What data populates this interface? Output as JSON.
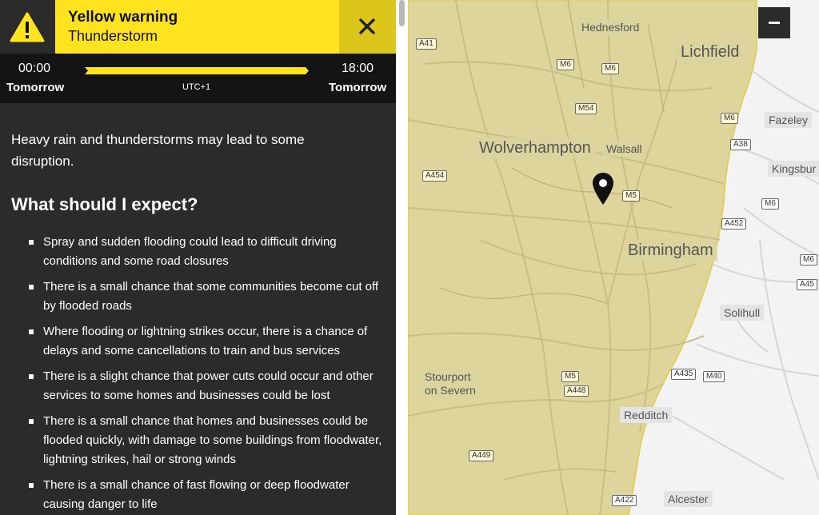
{
  "warning": {
    "level": "Yellow warning",
    "type": "Thunderstorm",
    "icon": "warning-triangle-icon",
    "accent_color": "#ffe31f"
  },
  "timeline": {
    "start_time": "00:00",
    "start_day": "Tomorrow",
    "end_time": "18:00",
    "end_day": "Tomorrow",
    "timezone": "UTC+1"
  },
  "content": {
    "summary": "Heavy rain and thunderstorms may lead to some disruption.",
    "expect_heading": "What should I expect?",
    "bullets": [
      "Spray and sudden flooding could lead to difficult driving conditions and some road closures",
      "There is a small chance that some communities become cut off by flooded roads",
      "Where flooding or lightning strikes occur, there is a chance of delays and some cancellations to train and bus services",
      "There is a slight chance that power cuts could occur and other services to some homes and businesses could be lost",
      "There is a small chance that homes and businesses could be flooded quickly, with damage to some buildings from floodwater, lightning strikes, hail or strong winds",
      "There is a small chance of fast flowing or deep floodwater causing danger to life"
    ]
  },
  "map": {
    "places": {
      "hednesford": "Hednesford",
      "lichfield": "Lichfield",
      "fazeley": "Fazeley",
      "wolverhampton": "Wolverhampton",
      "walsall": "Walsall",
      "kingsbury": "Kingsbur",
      "birmingham": "Birmingham",
      "solihull": "Solihull",
      "stourport_1": "Stourport",
      "stourport_2": "on Severn",
      "redditch": "Redditch",
      "alcester": "Alcester"
    },
    "roads": {
      "a41": "A41",
      "m6_a": "M6",
      "m6_b": "M6",
      "m54": "M54",
      "m6_c": "M6",
      "a38": "A38",
      "a454": "A454",
      "m5_a": "M5",
      "a452": "A452",
      "m6_d": "M6",
      "m6_e": "M6",
      "a45": "A45",
      "m5_b": "M5",
      "a448": "A448",
      "a435": "A435",
      "m40": "M40",
      "a449": "A449",
      "a422": "A422"
    },
    "zoom_control": "zoom-out",
    "warning_area_color": "#ddd59c"
  }
}
